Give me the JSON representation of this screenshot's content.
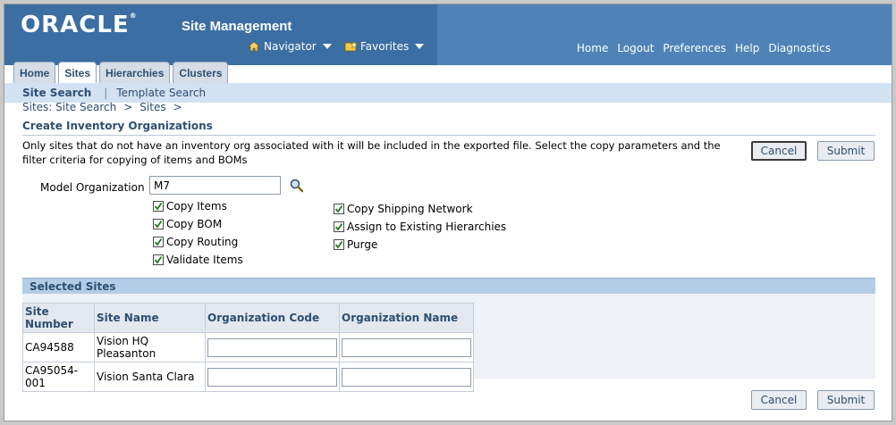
{
  "header": {
    "logo": "ORACLE",
    "logo_mark": "®",
    "app_title": "Site Management",
    "navigator": "Navigator",
    "favorites": "Favorites",
    "global_links": [
      "Home",
      "Logout",
      "Preferences",
      "Help",
      "Diagnostics"
    ]
  },
  "tabs": [
    {
      "label": "Home",
      "active": false
    },
    {
      "label": "Sites",
      "active": true
    },
    {
      "label": "Hierarchies",
      "active": false
    },
    {
      "label": "Clusters",
      "active": false
    }
  ],
  "subnav": {
    "active": "Site Search",
    "separator": "|",
    "other": "Template Search"
  },
  "breadcrumb": [
    "Sites: Site Search",
    ">",
    "Sites",
    ">"
  ],
  "page": {
    "title": "Create Inventory Organizations",
    "instructions": "Only sites that do not have an inventory org associated with it will be included in the exported file. Select the copy parameters and the filter criteria for copying of items and BOMs",
    "cancel_label": "Cancel",
    "submit_label": "Submit"
  },
  "form": {
    "model_org_label": "Model Organization",
    "model_org_value": "M7",
    "checkboxes_left": [
      {
        "label": "Copy Items",
        "checked": true
      },
      {
        "label": "Copy BOM",
        "checked": true
      },
      {
        "label": "Copy Routing",
        "checked": true
      },
      {
        "label": "Validate Items",
        "checked": true
      }
    ],
    "checkboxes_right": [
      {
        "label": "Copy Shipping Network",
        "checked": true
      },
      {
        "label": "Assign to Existing Hierarchies",
        "checked": true
      },
      {
        "label": "Purge",
        "checked": true
      }
    ]
  },
  "selected_sites": {
    "title": "Selected Sites",
    "columns": [
      "Site Number",
      "Site Name",
      "Organization Code",
      "Organization Name"
    ],
    "rows": [
      {
        "site_number": "CA94588",
        "site_name": "Vision HQ Pleasanton",
        "org_code": "",
        "org_name": ""
      },
      {
        "site_number": "CA95054-001",
        "site_name": "Vision Santa Clara",
        "org_code": "",
        "org_name": ""
      }
    ]
  },
  "colors": {
    "header": "#336699",
    "section": "#b4cde6",
    "text_link": "#2d4e72"
  }
}
